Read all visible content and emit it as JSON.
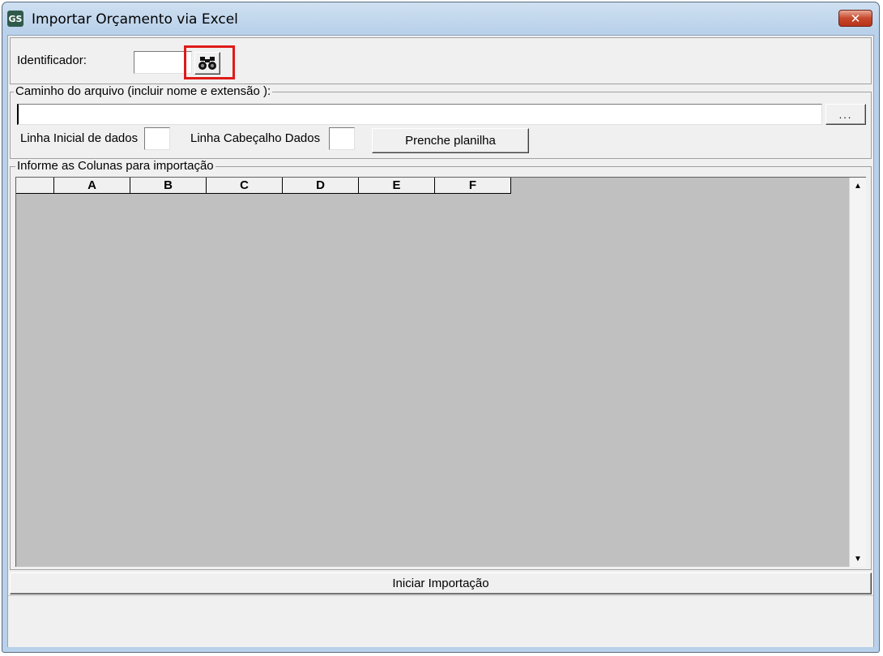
{
  "window": {
    "title": "Importar Orçamento via Excel",
    "icon_text": "GS",
    "close_label": "✕"
  },
  "identifier": {
    "label": "Identificador:",
    "value": ""
  },
  "file": {
    "legend": "Caminho do arquivo (incluir nome e extensão ):",
    "path_value": "",
    "browse_label": "...",
    "start_row_label": "Linha Inicial de dados",
    "header_row_label": "Linha Cabeçalho Dados",
    "fill_button": "Prenche planilha"
  },
  "columns": {
    "legend": "Informe as Colunas para importação",
    "headers": [
      "",
      "A",
      "B",
      "C",
      "D",
      "E",
      "F"
    ]
  },
  "actions": {
    "start_import": "Iniciar Importação"
  },
  "icons": {
    "find": "binoculars-icon",
    "scroll_up": "arrow-up-icon",
    "scroll_down": "arrow-down-icon"
  },
  "colors": {
    "highlight": "#e01a1a",
    "grid_bg": "#c0c0c0"
  }
}
